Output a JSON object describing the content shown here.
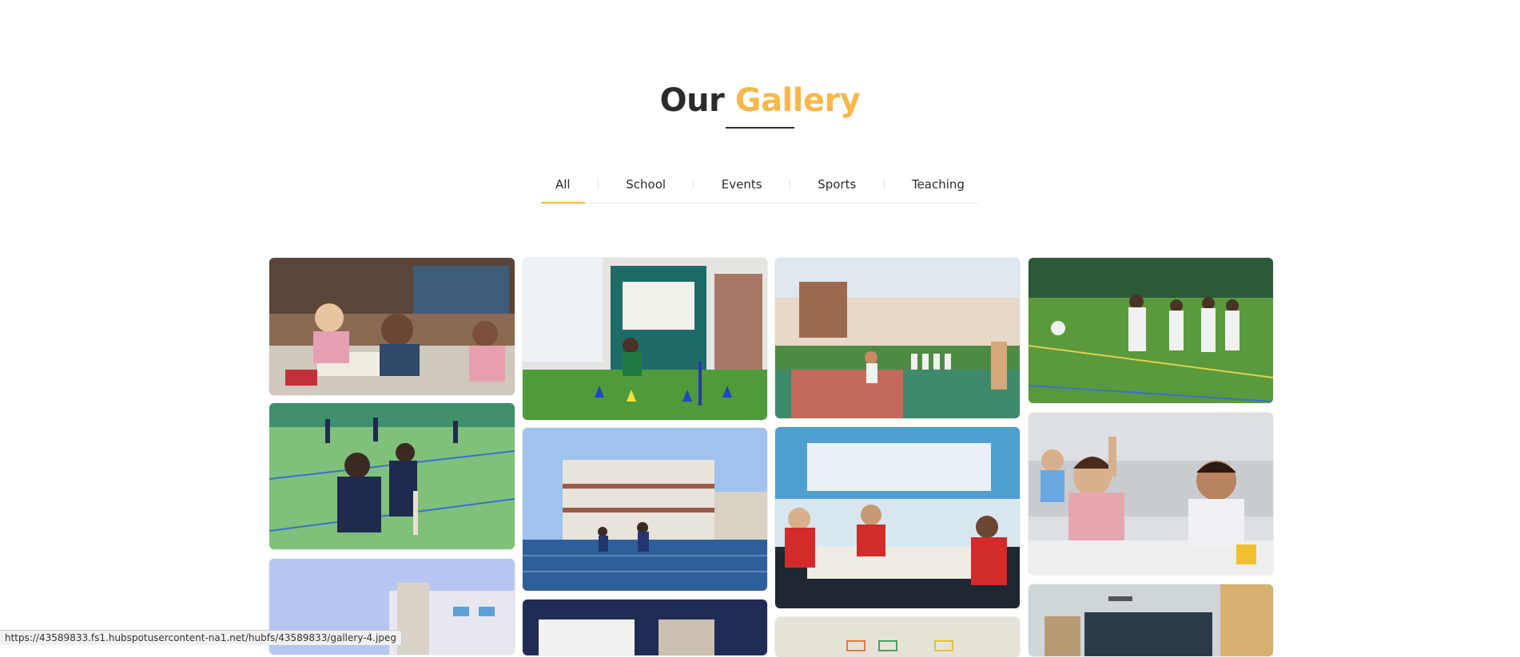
{
  "heading": {
    "word1": "Our",
    "word2": "Gallery"
  },
  "filters": {
    "tabs": [
      "All",
      "School",
      "Events",
      "Sports",
      "Teaching"
    ],
    "active": "All"
  },
  "gallery": {
    "images": [
      {
        "subject": "classroom-raised-hands"
      },
      {
        "subject": "sports-day-obstacle-run"
      },
      {
        "subject": "basketball-court"
      },
      {
        "subject": "football-field"
      },
      {
        "subject": "cricket-practice"
      },
      {
        "subject": "school-building-running-track"
      },
      {
        "subject": "classroom-red-uniforms"
      },
      {
        "subject": "happy-students-desk"
      },
      {
        "subject": "school-building-exterior"
      },
      {
        "subject": "presentation-slide"
      },
      {
        "subject": "classroom-wall"
      },
      {
        "subject": "classroom-maps"
      }
    ]
  },
  "status_bar": {
    "url": "https://43589833.fs1.hubspotusercontent-na1.net/hubfs/43589833/gallery-4.jpeg"
  },
  "colors": {
    "accent": "#f6b84b",
    "text": "#2b2b2b"
  }
}
